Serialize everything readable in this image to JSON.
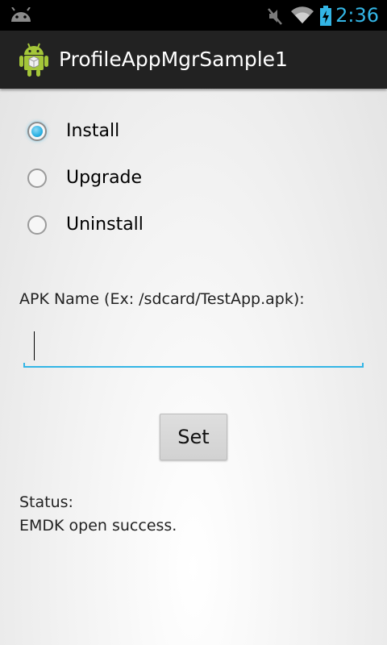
{
  "status_bar": {
    "time": "2:36",
    "icons": [
      "android-notification-icon",
      "mute-icon",
      "wifi-icon",
      "battery-charging-icon"
    ],
    "accent_color": "#33b5e5"
  },
  "action_bar": {
    "title": "ProfileAppMgrSample1",
    "icon": "android-app-icon"
  },
  "options": {
    "install": "Install",
    "upgrade": "Upgrade",
    "uninstall": "Uninstall",
    "selected": "Install"
  },
  "apk": {
    "label": "APK Name (Ex: /sdcard/TestApp.apk):",
    "value": "",
    "placeholder": ""
  },
  "set_button": "Set",
  "status": {
    "title": "Status:",
    "message": "EMDK open success."
  }
}
